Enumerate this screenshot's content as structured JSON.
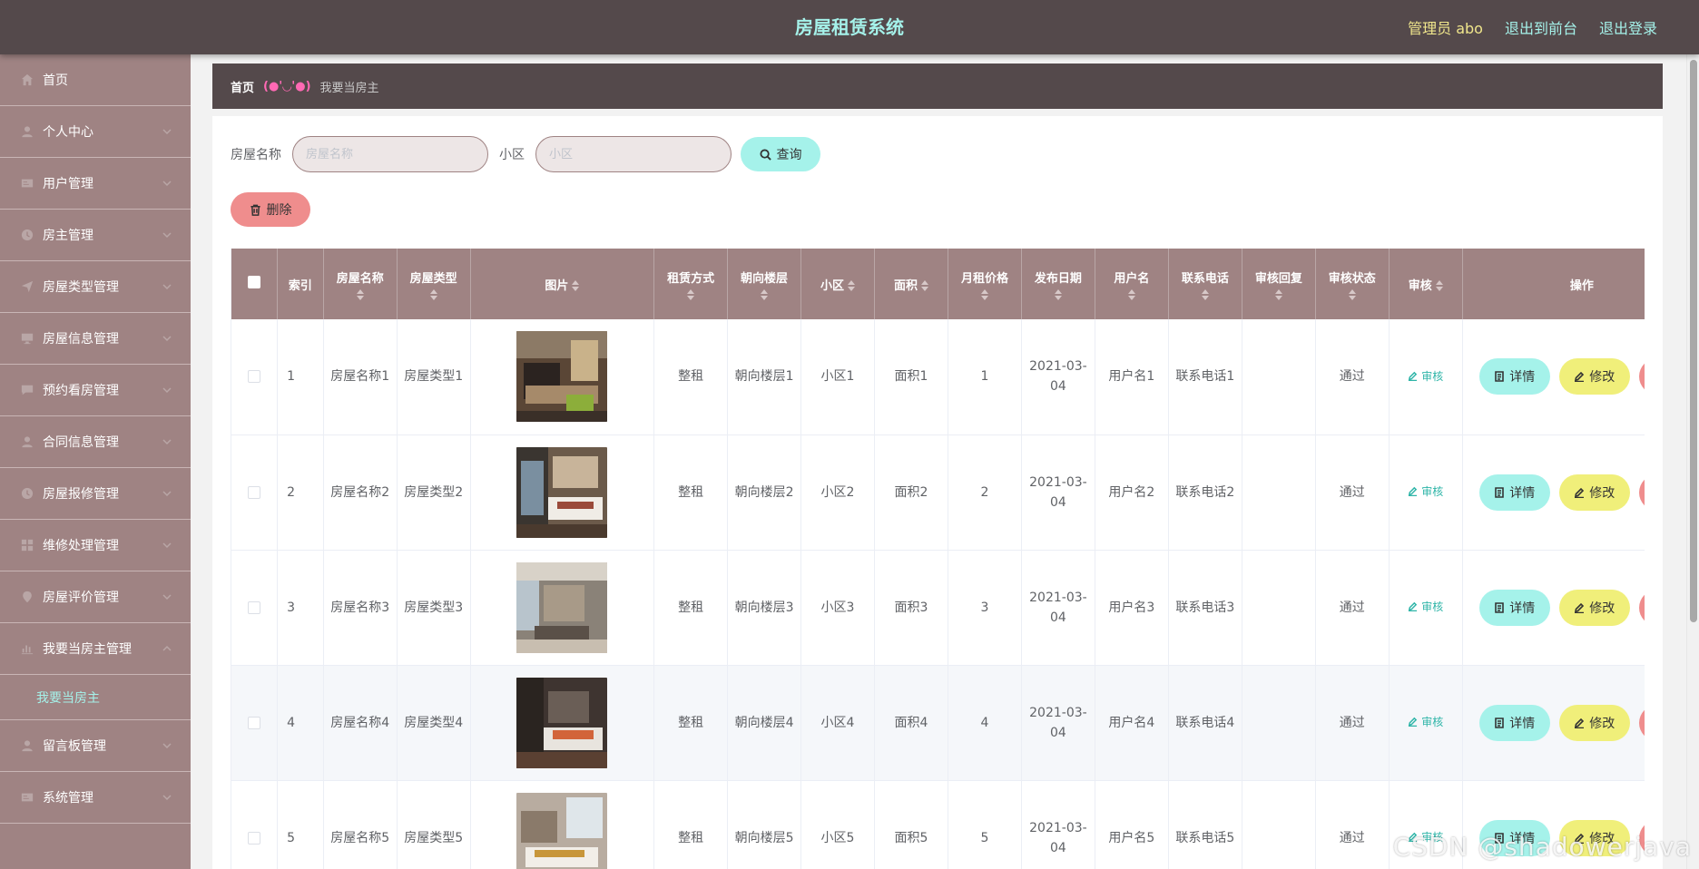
{
  "header": {
    "title": "房屋租赁系统",
    "admin_label": "管理员 abo",
    "front_link": "退出到前台",
    "logout_link": "退出登录"
  },
  "sidebar": {
    "items": [
      {
        "label": "首页",
        "icon": "home-icon"
      },
      {
        "label": "个人中心",
        "icon": "user-icon"
      },
      {
        "label": "用户管理",
        "icon": "id-card-icon"
      },
      {
        "label": "房主管理",
        "icon": "clock-icon"
      },
      {
        "label": "房屋类型管理",
        "icon": "send-icon"
      },
      {
        "label": "房屋信息管理",
        "icon": "monitor-icon"
      },
      {
        "label": "预约看房管理",
        "icon": "message-icon"
      },
      {
        "label": "合同信息管理",
        "icon": "user-icon"
      },
      {
        "label": "房屋报修管理",
        "icon": "clock-icon"
      },
      {
        "label": "维修处理管理",
        "icon": "grid-icon"
      },
      {
        "label": "房屋评价管理",
        "icon": "location-icon"
      },
      {
        "label": "我要当房主管理",
        "icon": "chart-icon"
      },
      {
        "label": "留言板管理",
        "icon": "user-icon"
      },
      {
        "label": "系统管理",
        "icon": "id-card-icon"
      }
    ],
    "sub_item": "我要当房主"
  },
  "breadcrumb": {
    "home": "首页",
    "separator": "(●'◡'●)",
    "current": "我要当房主"
  },
  "search": {
    "name_label": "房屋名称",
    "name_placeholder": "房屋名称",
    "community_label": "小区",
    "community_placeholder": "小区",
    "query_button": "查询"
  },
  "delete_button": "删除",
  "table": {
    "columns": [
      "索引",
      "房屋名称",
      "房屋类型",
      "图片",
      "租赁方式",
      "朝向楼层",
      "小区",
      "面积",
      "月租价格",
      "发布日期",
      "用户名",
      "联系电话",
      "审核回复",
      "审核状态",
      "审核",
      "操作"
    ],
    "rows": [
      {
        "index": "1",
        "name": "房屋名称1",
        "type": "房屋类型1",
        "rent": "整租",
        "floor": "朝向楼层1",
        "community": "小区1",
        "area": "面积1",
        "price": "1",
        "date": "2021-03-04",
        "user": "用户名1",
        "phone": "联系电话1",
        "reply": "",
        "status": "通过",
        "audit": "审核"
      },
      {
        "index": "2",
        "name": "房屋名称2",
        "type": "房屋类型2",
        "rent": "整租",
        "floor": "朝向楼层2",
        "community": "小区2",
        "area": "面积2",
        "price": "2",
        "date": "2021-03-04",
        "user": "用户名2",
        "phone": "联系电话2",
        "reply": "",
        "status": "通过",
        "audit": "审核"
      },
      {
        "index": "3",
        "name": "房屋名称3",
        "type": "房屋类型3",
        "rent": "整租",
        "floor": "朝向楼层3",
        "community": "小区3",
        "area": "面积3",
        "price": "3",
        "date": "2021-03-04",
        "user": "用户名3",
        "phone": "联系电话3",
        "reply": "",
        "status": "通过",
        "audit": "审核"
      },
      {
        "index": "4",
        "name": "房屋名称4",
        "type": "房屋类型4",
        "rent": "整租",
        "floor": "朝向楼层4",
        "community": "小区4",
        "area": "面积4",
        "price": "4",
        "date": "2021-03-04",
        "user": "用户名4",
        "phone": "联系电话4",
        "reply": "",
        "status": "通过",
        "audit": "审核"
      },
      {
        "index": "5",
        "name": "房屋名称5",
        "type": "房屋类型5",
        "rent": "整租",
        "floor": "朝向楼层5",
        "community": "小区5",
        "area": "面积5",
        "price": "5",
        "date": "2021-03-04",
        "user": "用户名5",
        "phone": "联系电话5",
        "reply": "",
        "status": "通过",
        "audit": "审核"
      }
    ],
    "actions": {
      "detail": "详情",
      "edit": "修改",
      "delete": "删除"
    }
  },
  "watermark": "CSDN @shadowerjava",
  "colors": {
    "header_bg": "#54494b",
    "title": "#a5f2ea",
    "admin": "#f0e68c",
    "sidebar_bg": "#9f8383",
    "table_head_bg": "#9f8383",
    "btn_cyan": "#a5f2ea",
    "btn_yellow": "#f0ef7a",
    "btn_red": "#ef8d8d"
  }
}
